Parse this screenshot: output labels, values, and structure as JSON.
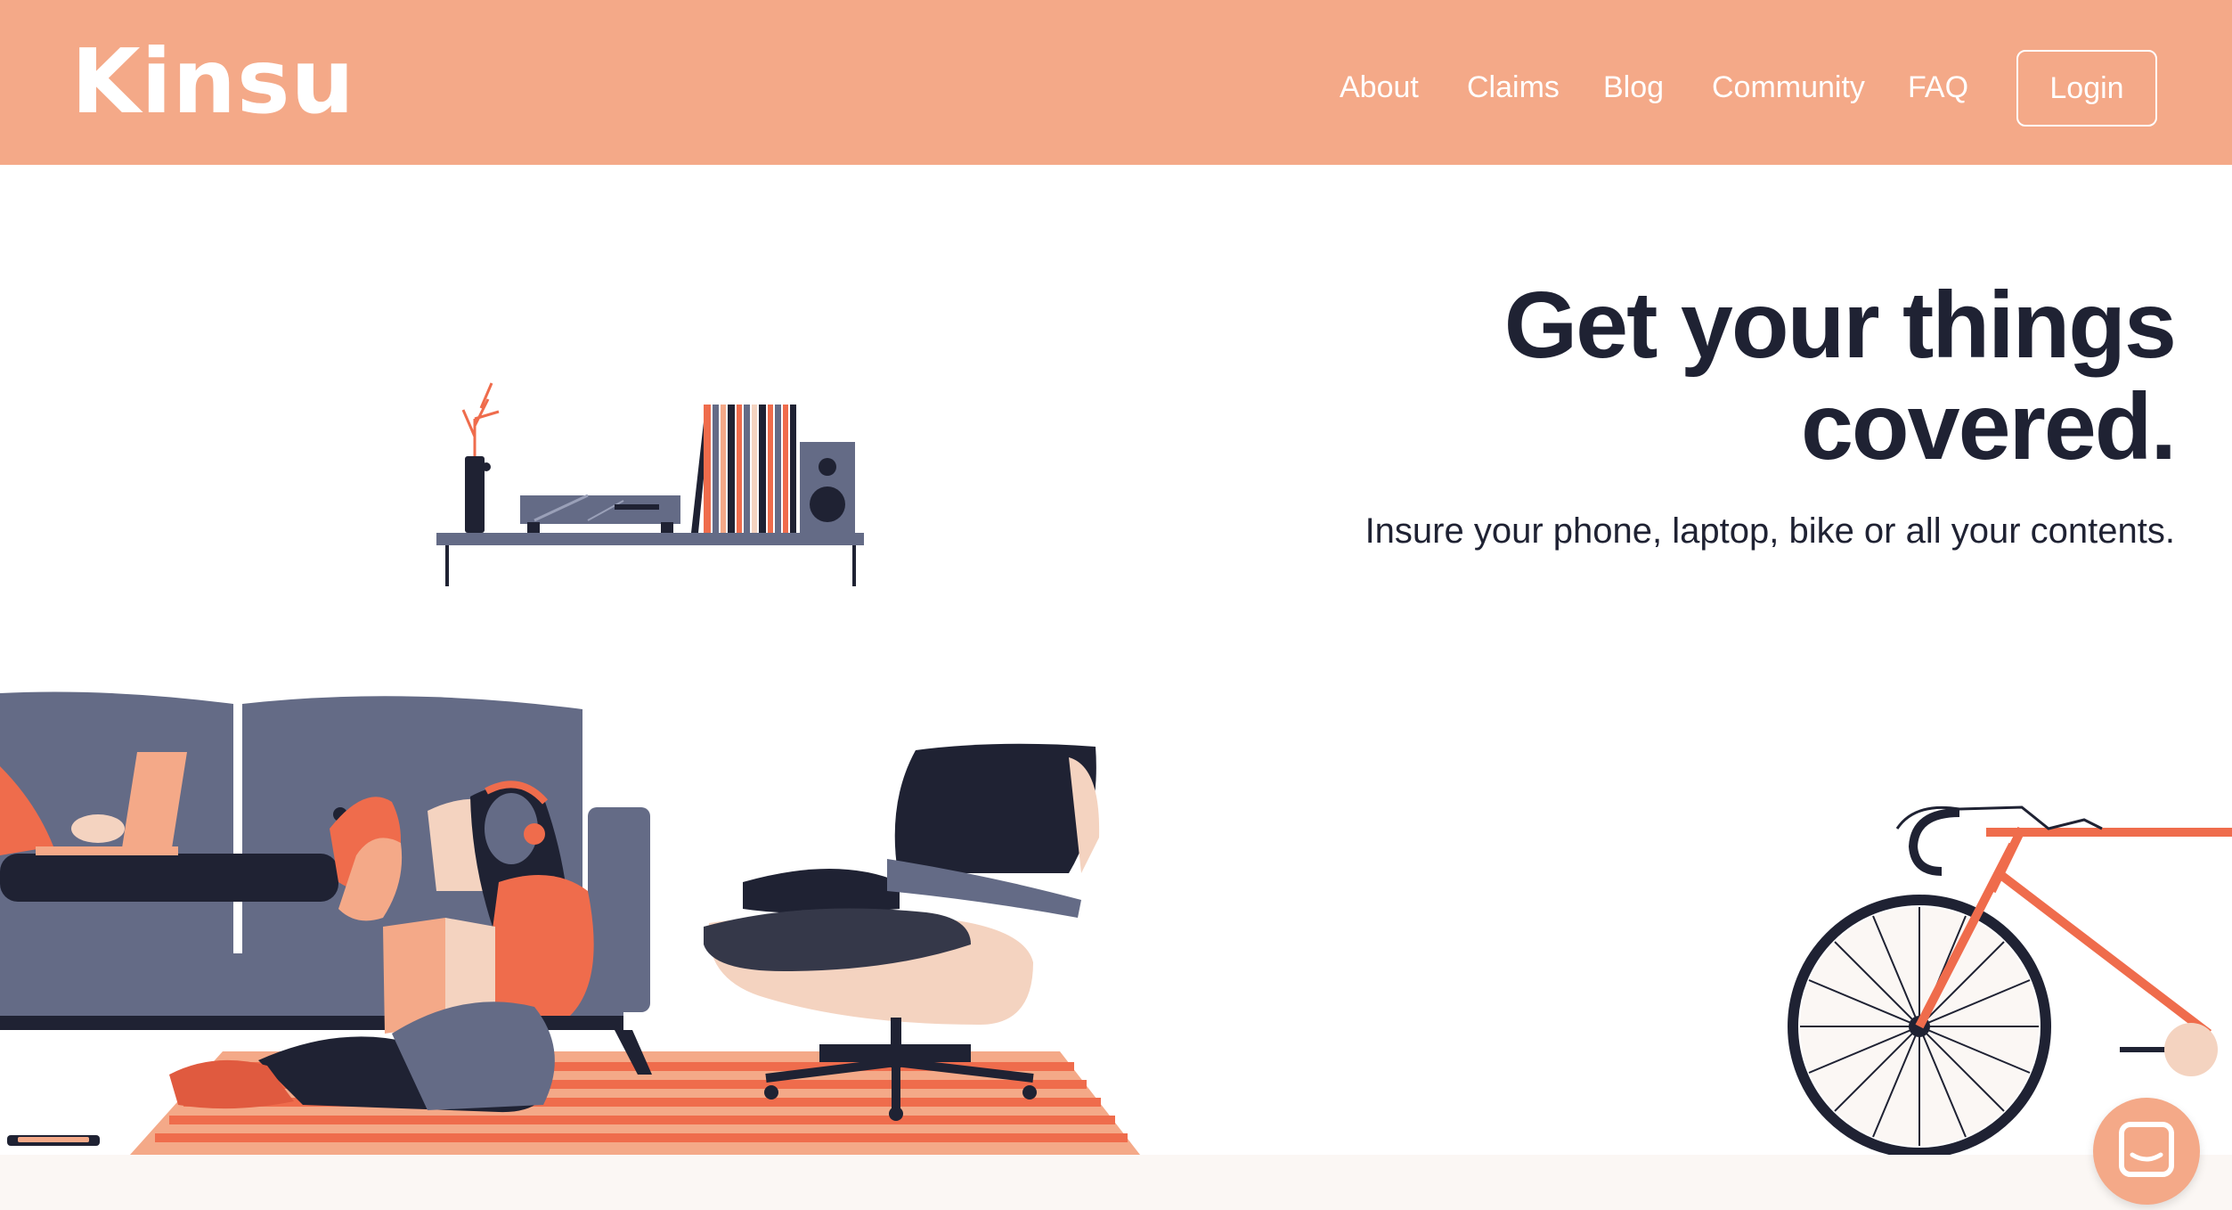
{
  "header": {
    "logo": "Kinsu",
    "nav": [
      {
        "label": "About"
      },
      {
        "label": "Claims"
      },
      {
        "label": "Blog"
      },
      {
        "label": "Community"
      },
      {
        "label": "FAQ"
      }
    ],
    "login_label": "Login"
  },
  "hero": {
    "title_line1": "Get your things",
    "title_line2": "covered.",
    "subtitle": "Insure your phone, laptop, bike or all your contents."
  },
  "chat": {
    "icon": "chat-icon"
  },
  "colors": {
    "brand": "#f4a988",
    "text_dark": "#1f2233",
    "accent": "#ef6c4c",
    "slate": "#646b86"
  }
}
